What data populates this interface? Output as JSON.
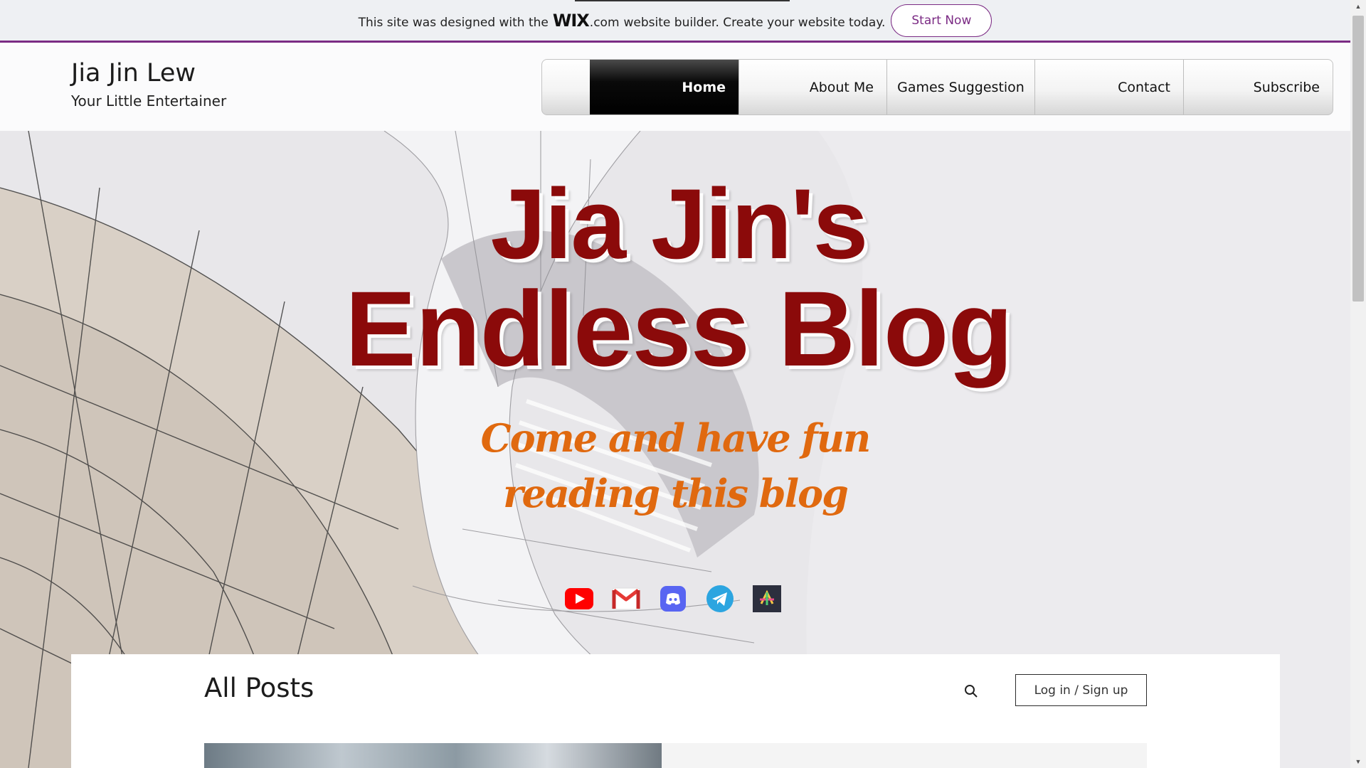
{
  "wix_banner": {
    "text_before": "This site was designed with the",
    "logo": "WIX",
    "logo_tail": ".com",
    "text_after": "website builder. Create your website today.",
    "cta_label": "Start Now",
    "accent_color": "#7b2b84"
  },
  "site": {
    "title": "Jia Jin Lew",
    "tagline": "Your Little Entertainer"
  },
  "nav": {
    "items": [
      {
        "label": "Home",
        "active": true
      },
      {
        "label": "About Me"
      },
      {
        "label": "Games Suggestion"
      },
      {
        "label": "Contact"
      },
      {
        "label": "Subscribe"
      }
    ]
  },
  "hero": {
    "title_line1": "Jia Jin's",
    "title_line2": "Endless Blog",
    "subtitle_line1": "Come and have fun",
    "subtitle_line2": "reading this blog",
    "title_color": "#8b0a0a",
    "subtitle_color": "#e0690f"
  },
  "socials": [
    {
      "name": "youtube-icon"
    },
    {
      "name": "gmail-icon"
    },
    {
      "name": "discord-icon"
    },
    {
      "name": "telegram-icon"
    },
    {
      "name": "app-icon"
    }
  ],
  "blog": {
    "heading": "All Posts",
    "search_icon": "search-icon",
    "login_label": "Log in / Sign up"
  }
}
